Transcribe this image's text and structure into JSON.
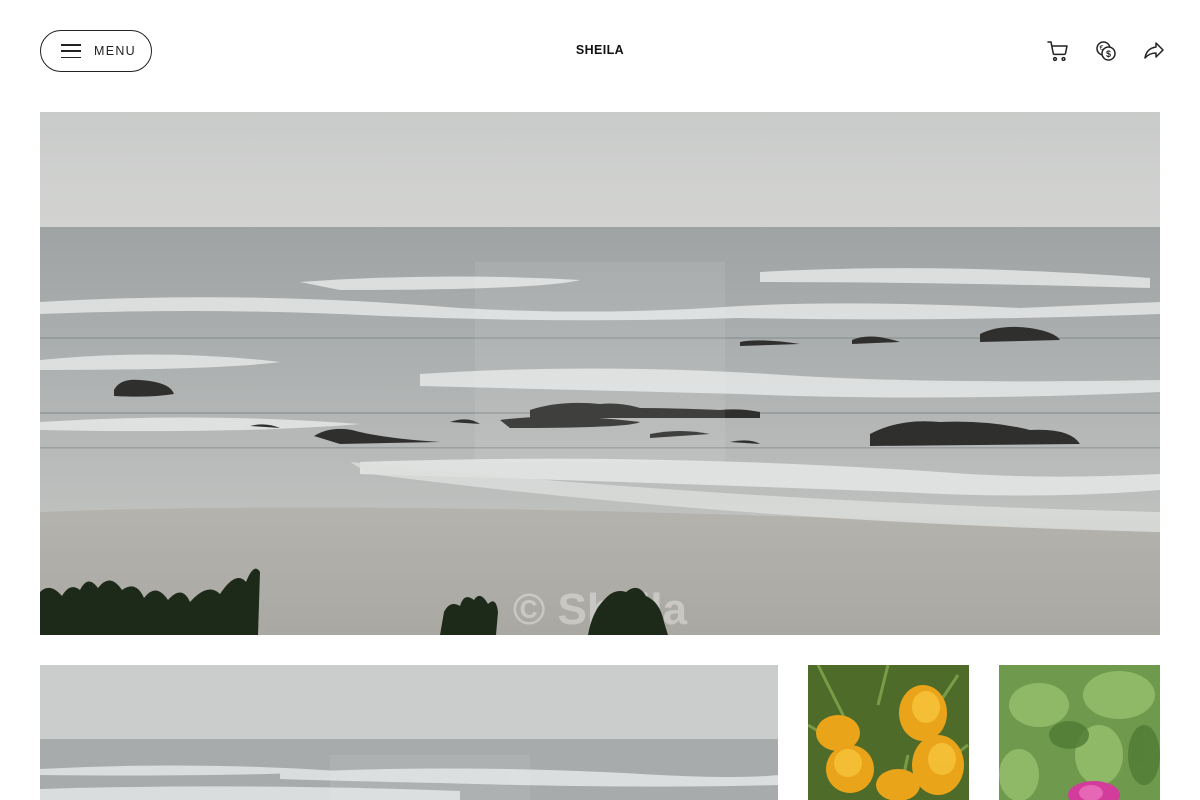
{
  "header": {
    "menu_label": "MENU",
    "site_title": "SHEILA",
    "icons": [
      "cart-icon",
      "currency-exchange-icon",
      "share-icon"
    ]
  },
  "hero": {
    "watermark": "© Sheila",
    "subject": "seascape"
  },
  "gallery": {
    "tiles": [
      {
        "subject": "seascape"
      },
      {
        "subject": "yellow-flower"
      },
      {
        "subject": "pink-flower"
      }
    ]
  },
  "colors": {
    "text": "#111111",
    "border": "#222222",
    "background": "#ffffff"
  }
}
